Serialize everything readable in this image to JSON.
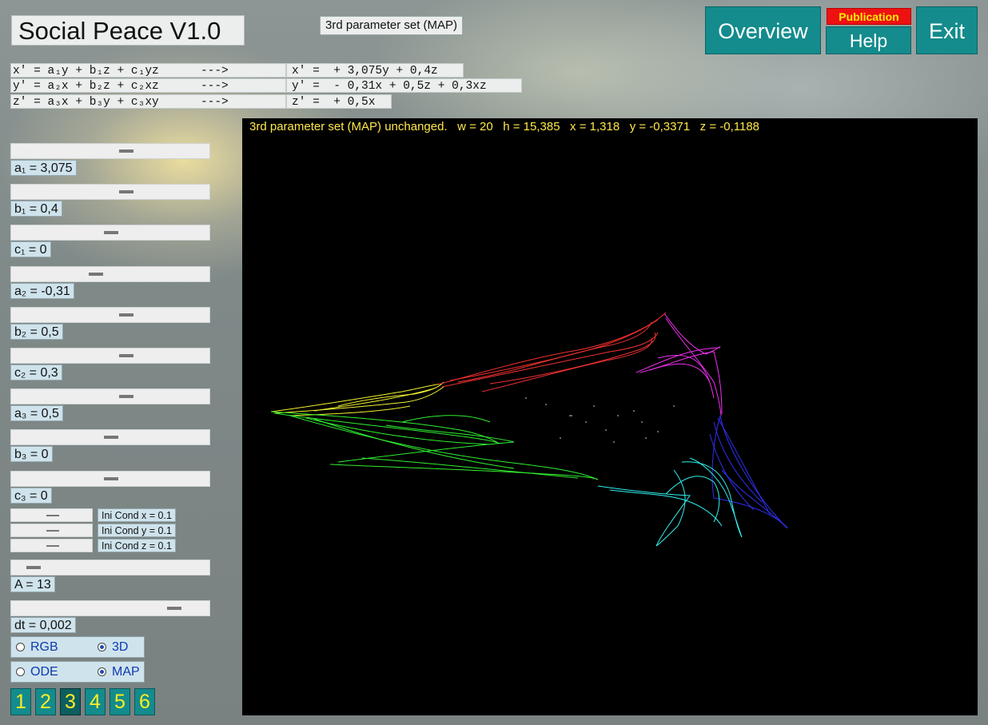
{
  "app_title": "Social Peace V1.0",
  "mode_label": "3rd parameter set (MAP)",
  "buttons": {
    "overview": "Overview",
    "publication": "Publication",
    "help": "Help",
    "exit": "Exit"
  },
  "equations": [
    {
      "general": "x' = a₁y + b₁z + c₁yz      --->",
      "specific": "x' =  + 3,075y + 0,4z"
    },
    {
      "general": "y' = a₂x + b₂z + c₂xz      --->",
      "specific": "y' =  - 0,31x + 0,5z + 0,3xz"
    },
    {
      "general": "z' = a₃x + b₃y + c₃xy      --->",
      "specific": "z' =  + 0,5x"
    }
  ],
  "status_text": "3rd parameter set (MAP) unchanged.   w = 20   h = 15,385   x = 1,318   y = -0,3371   z = -0,1188",
  "parameters": [
    {
      "label": "a₁ = 3,075",
      "level": 0.58
    },
    {
      "label": "b₁ = 0,4",
      "level": 0.58
    },
    {
      "label": "c₁ = 0",
      "level": 0.5
    },
    {
      "label": "a₂ = -0,31",
      "level": 0.42
    },
    {
      "label": "b₂ = 0,5",
      "level": 0.58
    },
    {
      "label": "c₂ = 0,3",
      "level": 0.58
    },
    {
      "label": "a₃ = 0,5",
      "level": 0.58
    },
    {
      "label": "b₃ = 0",
      "level": 0.5
    },
    {
      "label": "c₃ = 0",
      "level": 0.5
    }
  ],
  "initial_conditions": [
    {
      "label": "Ini Cond x = 0.1",
      "level": 0.5
    },
    {
      "label": "Ini Cond y = 0.1",
      "level": 0.5
    },
    {
      "label": "Ini Cond z = 0.1",
      "level": 0.5
    }
  ],
  "amplitude": {
    "label": "A  = 13",
    "level": 0.08
  },
  "timestep": {
    "label": "dt = 0,002",
    "level": 0.84
  },
  "radio_groups": [
    {
      "options": [
        {
          "label": "RGB",
          "selected": false
        },
        {
          "label": "3D",
          "selected": true
        }
      ]
    },
    {
      "options": [
        {
          "label": "ODE",
          "selected": false
        },
        {
          "label": "MAP",
          "selected": true
        }
      ]
    }
  ],
  "parameter_sets": [
    "1",
    "2",
    "3",
    "4",
    "5",
    "6"
  ],
  "active_set": "3",
  "attractor_colors": [
    "#ffff33",
    "#ff3333",
    "#ff33ff",
    "#3333ff",
    "#33ffff",
    "#33ff33"
  ],
  "icons": {
    "radio": "radio-button-icon"
  }
}
